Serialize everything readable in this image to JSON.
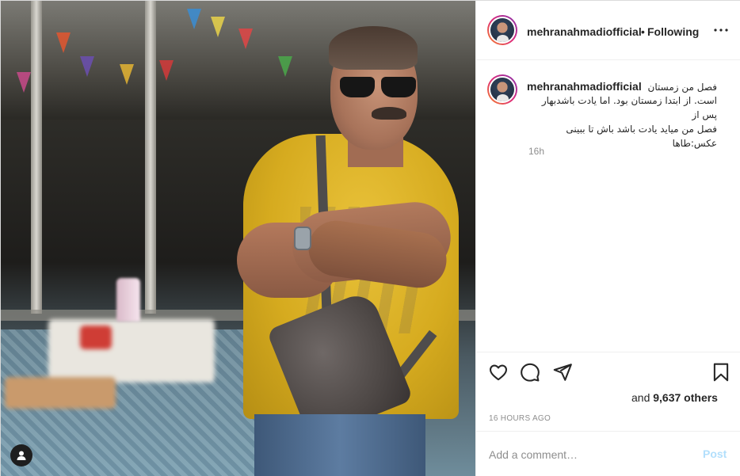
{
  "post": {
    "author": {
      "username": "mehranahmadiofficial",
      "separator": "•",
      "follow_status": "Following"
    },
    "caption": {
      "username": "mehranahmadiofficial",
      "lines": [
        "فصل من زمستان",
        "است. از ابتدا زمستان بود. اما یادت باشدبهار پس از",
        "فصل من میاید یادت باشد باش تا ببینی",
        "عکس:طاها"
      ],
      "time": "16h"
    },
    "actions": {
      "like_icon": "heart-icon",
      "comment_icon": "comment-icon",
      "share_icon": "paper-plane-icon",
      "save_icon": "bookmark-icon",
      "more_icon": "more-horizontal-icon",
      "user_tag_icon": "user-tag-icon"
    },
    "likes": {
      "prefix": "and ",
      "count_text": "9,637 others"
    },
    "timestamp": "16 HOURS AGO",
    "comment": {
      "placeholder": "Add a comment…",
      "post_label": "Post"
    }
  },
  "colors": {
    "text": "#262626",
    "secondary": "#8e8e8e",
    "border": "#dbdbdb",
    "post_button_disabled": "#b2dffc",
    "story_ring": [
      "#f58529",
      "#dd2a7b",
      "#8134af"
    ]
  }
}
